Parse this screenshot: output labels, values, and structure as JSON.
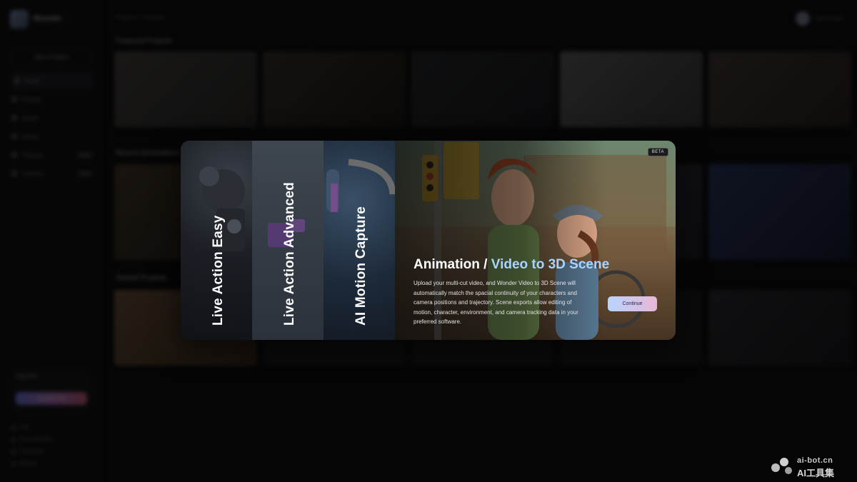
{
  "app": {
    "name": "Wonder",
    "breadcrumb": "Projects / Featured",
    "user": "User Account"
  },
  "sidebar": {
    "new_button": "New Project",
    "items": [
      {
        "label": "Home",
        "badge": ""
      },
      {
        "label": "Projects",
        "badge": ""
      },
      {
        "label": "Assets",
        "badge": ""
      },
      {
        "label": "Library",
        "badge": ""
      },
      {
        "label": "Training",
        "badge": "New"
      },
      {
        "label": "Tutorials",
        "badge": "New"
      }
    ],
    "plan_label": "Upgrade",
    "upgrade_button": "Upgrade Plan",
    "bottom_items": [
      "Help",
      "Documentation",
      "Community",
      "Settings"
    ]
  },
  "sections": [
    {
      "title": "Featured Projects"
    },
    {
      "title": "Recent Generations"
    },
    {
      "title": "Shared Projects"
    }
  ],
  "modal": {
    "panels": [
      {
        "label": "Live Action Easy"
      },
      {
        "label": "Live Action Advanced"
      },
      {
        "label": "AI Motion Capture"
      }
    ],
    "hero": {
      "badge": "BETA",
      "title_prefix": "Animation / ",
      "title_accent": "Video to 3D Scene",
      "description": "Upload your multi-cut video, and Wonder Video to 3D Scene will automatically match the spacial continuity of your characters and camera positions and trajectory. Scene exports allow editing of motion, character, environment, and camera tracking data in your preferred software.",
      "button": "Continue"
    }
  },
  "watermark": {
    "url": "ai-bot.cn",
    "text": "AI工具集"
  },
  "colors": {
    "accent": "#a9d4ff",
    "button_gradient_start": "#b7d4ff",
    "button_gradient_end": "#eab6d8"
  }
}
